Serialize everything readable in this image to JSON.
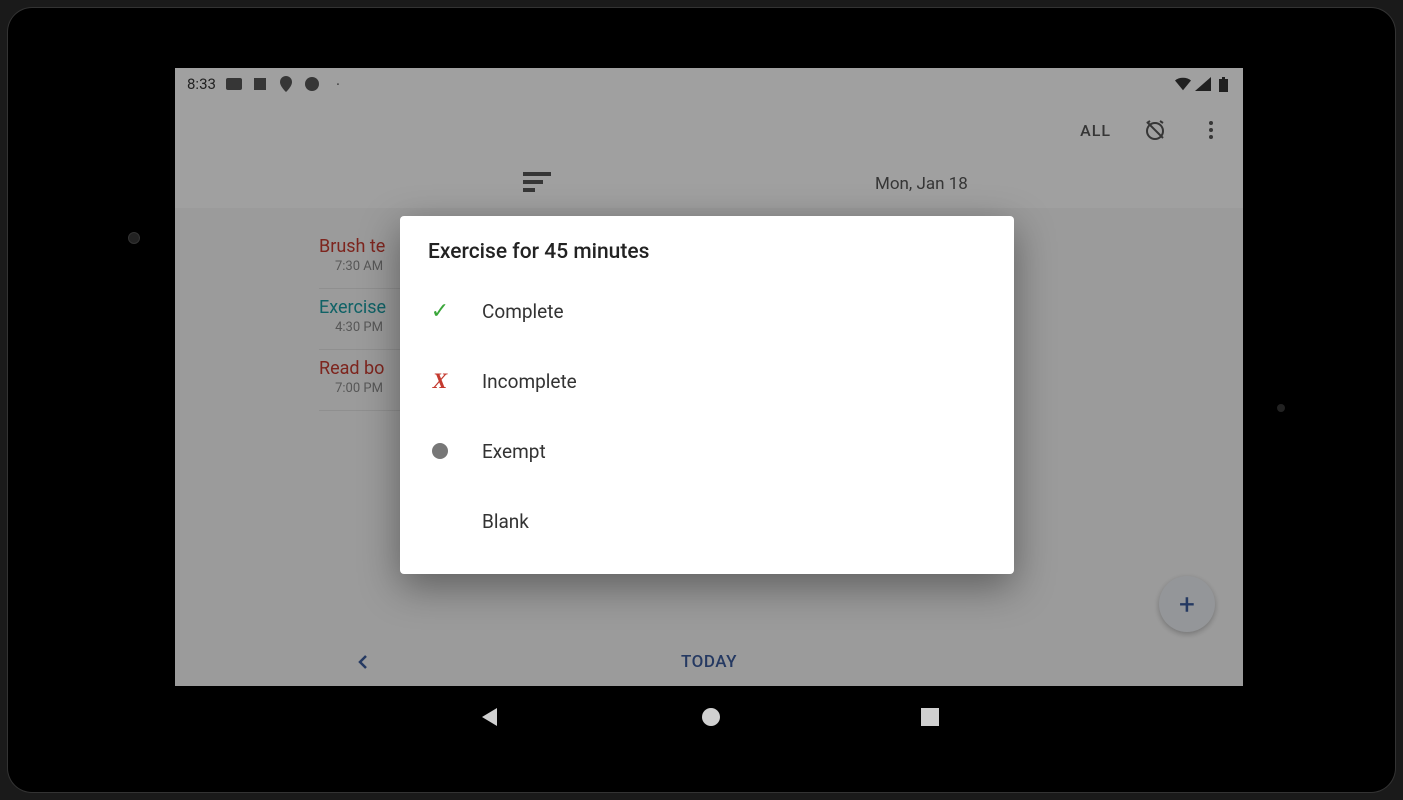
{
  "status": {
    "time": "8:33",
    "icons_left": [
      "message-icon",
      "square-icon",
      "location-icon",
      "p-icon",
      "dot-icon"
    ],
    "icons_right": [
      "wifi-icon",
      "signal-icon",
      "battery-icon"
    ]
  },
  "appbar": {
    "filter_label": "ALL"
  },
  "header": {
    "date": "Mon, Jan 18"
  },
  "habits": [
    {
      "title": "Brush te",
      "time": "7:30 AM",
      "color": "red"
    },
    {
      "title": "Exercise",
      "time": "4:30 PM",
      "color": "teal"
    },
    {
      "title": "Read bo",
      "time": "7:00 PM",
      "color": "red"
    }
  ],
  "bottom": {
    "today_label": "TODAY"
  },
  "dialog": {
    "title": "Exercise for 45 minutes",
    "options": [
      {
        "icon": "check",
        "label": "Complete"
      },
      {
        "icon": "x",
        "label": "Incomplete"
      },
      {
        "icon": "dot",
        "label": "Exempt"
      },
      {
        "icon": "",
        "label": "Blank"
      }
    ]
  }
}
